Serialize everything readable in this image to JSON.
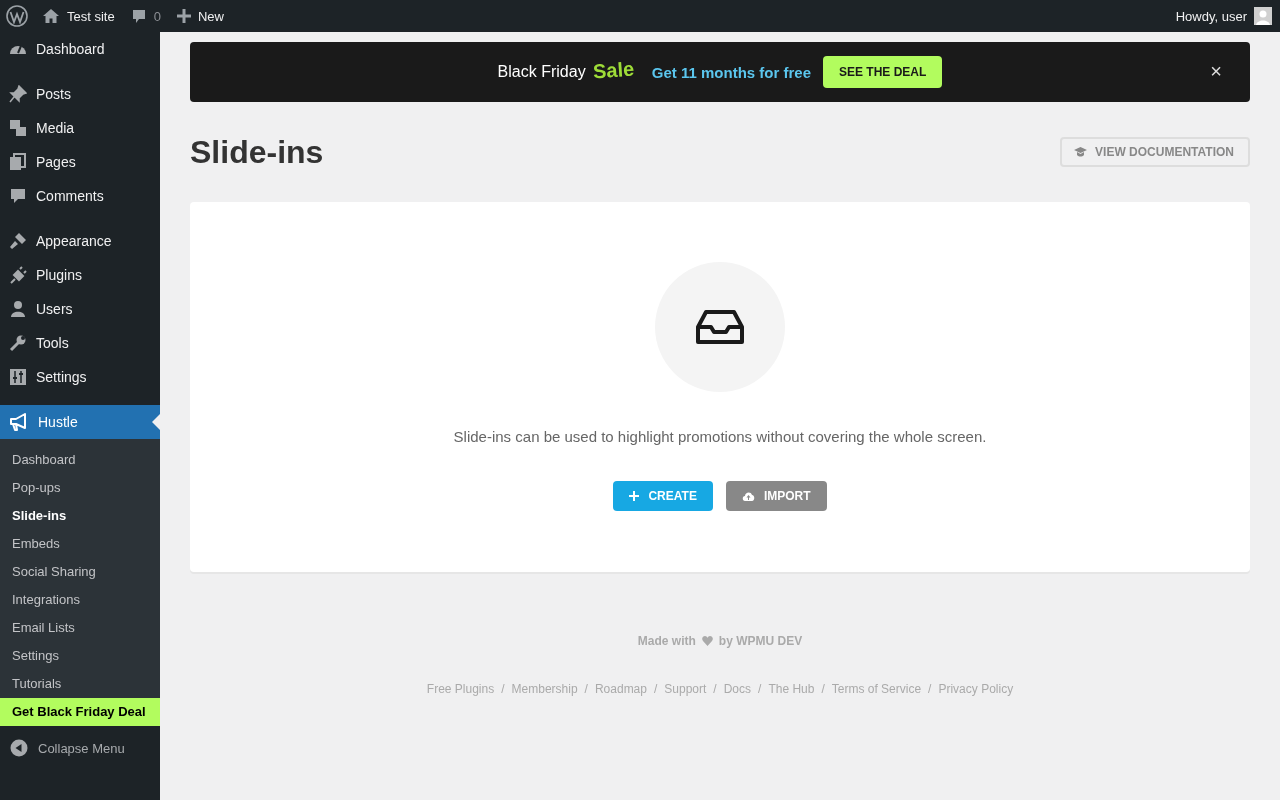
{
  "admin_bar": {
    "site_name": "Test site",
    "comments_count": "0",
    "new_label": "New",
    "greeting": "Howdy, user"
  },
  "sidebar": {
    "groups": [
      [
        {
          "label": "Dashboard",
          "selected": false
        }
      ],
      [
        {
          "label": "Posts",
          "selected": false
        },
        {
          "label": "Media",
          "selected": false
        },
        {
          "label": "Pages",
          "selected": false
        },
        {
          "label": "Comments",
          "selected": false
        }
      ],
      [
        {
          "label": "Appearance",
          "selected": false
        },
        {
          "label": "Plugins",
          "selected": false
        },
        {
          "label": "Users",
          "selected": false
        },
        {
          "label": "Tools",
          "selected": false
        },
        {
          "label": "Settings",
          "selected": false
        }
      ],
      [
        {
          "label": "Hustle",
          "selected": true
        }
      ]
    ],
    "submenu": [
      {
        "label": "Dashboard",
        "selected": false,
        "kind": "link"
      },
      {
        "label": "Pop-ups",
        "selected": false,
        "kind": "link"
      },
      {
        "label": "Slide-ins",
        "selected": true,
        "kind": "link"
      },
      {
        "label": "Embeds",
        "selected": false,
        "kind": "link"
      },
      {
        "label": "Social Sharing",
        "selected": false,
        "kind": "link"
      },
      {
        "label": "Integrations",
        "selected": false,
        "kind": "link"
      },
      {
        "label": "Email Lists",
        "selected": false,
        "kind": "link"
      },
      {
        "label": "Settings",
        "selected": false,
        "kind": "link"
      },
      {
        "label": "Tutorials",
        "selected": false,
        "kind": "link"
      },
      {
        "label": "Get Black Friday Deal",
        "selected": false,
        "kind": "promo"
      }
    ],
    "collapse_label": "Collapse Menu"
  },
  "banner": {
    "title": "Black Friday",
    "highlight": "Sale",
    "offer": "Get 11 months for free",
    "button": "SEE THE DEAL",
    "close": "×"
  },
  "page": {
    "title": "Slide-ins",
    "doc_button": "VIEW DOCUMENTATION"
  },
  "empty_state": {
    "message": "Slide-ins can be used to highlight promotions without covering the whole screen.",
    "buttons": [
      {
        "label": "CREATE",
        "kind": "primary"
      },
      {
        "label": "IMPORT",
        "kind": "secondary"
      }
    ]
  },
  "footer": {
    "made_with": "Made with",
    "by": "by WPMU DEV",
    "links": [
      "Free Plugins",
      "Membership",
      "Roadmap",
      "Support",
      "Docs",
      "The Hub",
      "Terms of Service",
      "Privacy Policy"
    ],
    "separator": "/"
  }
}
